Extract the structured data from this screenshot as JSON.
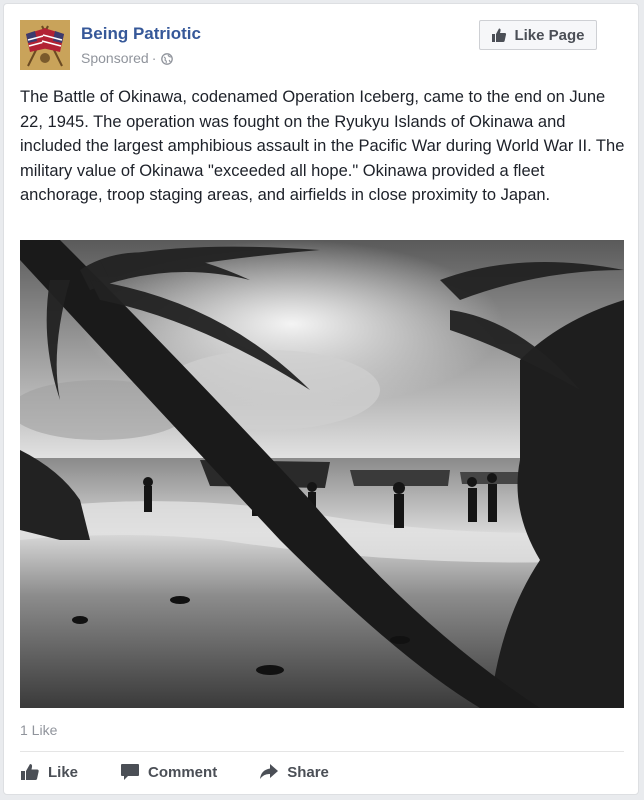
{
  "post": {
    "page_name": "Being Patriotic",
    "sponsored": "Sponsored",
    "dot": "·",
    "like_page_label": "Like Page",
    "text": "The Battle of Okinawa, codenamed Operation Iceberg, came to the end on June 22, 1945. The operation was fought on the Ryukyu Islands of Okinawa and included the largest amphibious assault in the Pacific War during World War II. The military value of Okinawa \"exceeded all hope.\" Okinawa provided a fleet anchorage, troop staging areas, and airfields in close proximity to Japan.",
    "likes_count": "1 Like"
  },
  "actions": {
    "like": "Like",
    "comment": "Comment",
    "share": "Share"
  },
  "icons": {
    "avatar": "crossed-flags-avatar",
    "audience": "globe-icon",
    "like": "thumbs-up-icon",
    "comment": "speech-bubble-icon",
    "share": "share-arrow-icon"
  },
  "colors": {
    "link": "#365899",
    "text": "#1d2129",
    "meta": "#90949c",
    "action": "#4b4f56"
  }
}
